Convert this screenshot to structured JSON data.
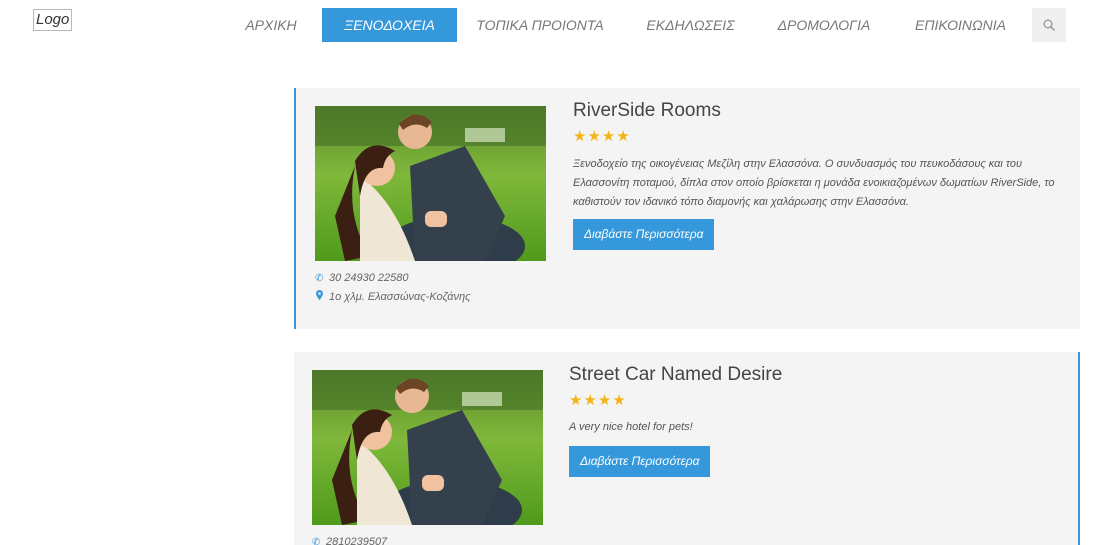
{
  "logo": {
    "text": "Logo"
  },
  "nav": {
    "items": [
      {
        "label": "ΑΡΧΙΚΗ"
      },
      {
        "label": "ΞΕΝΟΔΟΧΕΙΑ"
      },
      {
        "label": "ΤΟΠΙΚΑ ΠΡΟΙΟΝΤΑ"
      },
      {
        "label": "ΕΚΔΗΛΩΣΕΙΣ"
      },
      {
        "label": "ΔΡΟΜΟΛΟΓΙΑ"
      },
      {
        "label": "ΕΠΙΚΟΙΝΩΝΙΑ"
      }
    ],
    "active_index": 1,
    "search_icon": "search-icon"
  },
  "colors": {
    "accent": "#3498db",
    "star": "#f3b416",
    "card_bg": "#f4f4f4"
  },
  "hotels": [
    {
      "name": "RiverSide Rooms",
      "stars": 4,
      "stars_text": "★★★★",
      "description": "Ξενοδοχείο της οικογένειας Μεζίλη στην Ελασσόνα. Ο συνδυασμός του πευκοδάσους και του Ελασσονίτη ποταμού, δίπλα στον οποίο βρίσκεται η μονάδα ενοικιαζομένων δωματίων RiverSide, το καθιστούν τον ιδανικό τόπο διαμονής και χαλάρωσης στην Ελασσόνα.",
      "button_label": "Διαβάστε Περισσότερα",
      "phone": "30 24930 22580",
      "address": "1ο χλμ. Ελασσώνας-Κοζάνης"
    },
    {
      "name": "Street Car Named Desire",
      "stars": 4,
      "stars_text": "★★★★",
      "description": "A very nice hotel for pets!",
      "button_label": "Διαβάστε Περισσότερα",
      "phone": "2810239507"
    }
  ]
}
